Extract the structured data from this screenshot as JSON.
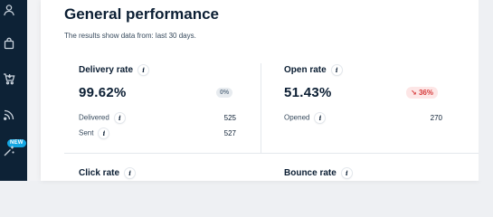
{
  "sidebar": {
    "items": [
      {
        "icon": "user-icon"
      },
      {
        "icon": "shopping-bag-icon"
      },
      {
        "icon": "cart-icon"
      },
      {
        "icon": "rss-icon"
      },
      {
        "icon": "magic-wand-icon",
        "badge": "NEW"
      }
    ]
  },
  "header": {
    "title": "General performance",
    "subtitle": "The results show data from: last 30 days."
  },
  "metrics": {
    "delivery": {
      "label": "Delivery rate",
      "value": "99.62%",
      "change": "0%",
      "rows": [
        {
          "label": "Delivered",
          "value": "525"
        },
        {
          "label": "Sent",
          "value": "527"
        }
      ]
    },
    "open": {
      "label": "Open rate",
      "value": "51.43%",
      "change": "36%",
      "change_icon": "arrow-down-right-icon",
      "rows": [
        {
          "label": "Opened",
          "value": "270"
        }
      ]
    },
    "click": {
      "label": "Click rate"
    },
    "bounce": {
      "label": "Bounce rate"
    }
  },
  "colors": {
    "sidebar": "#0d2236",
    "negative": "#d63b3b",
    "badge_new": "#14a6e2"
  }
}
